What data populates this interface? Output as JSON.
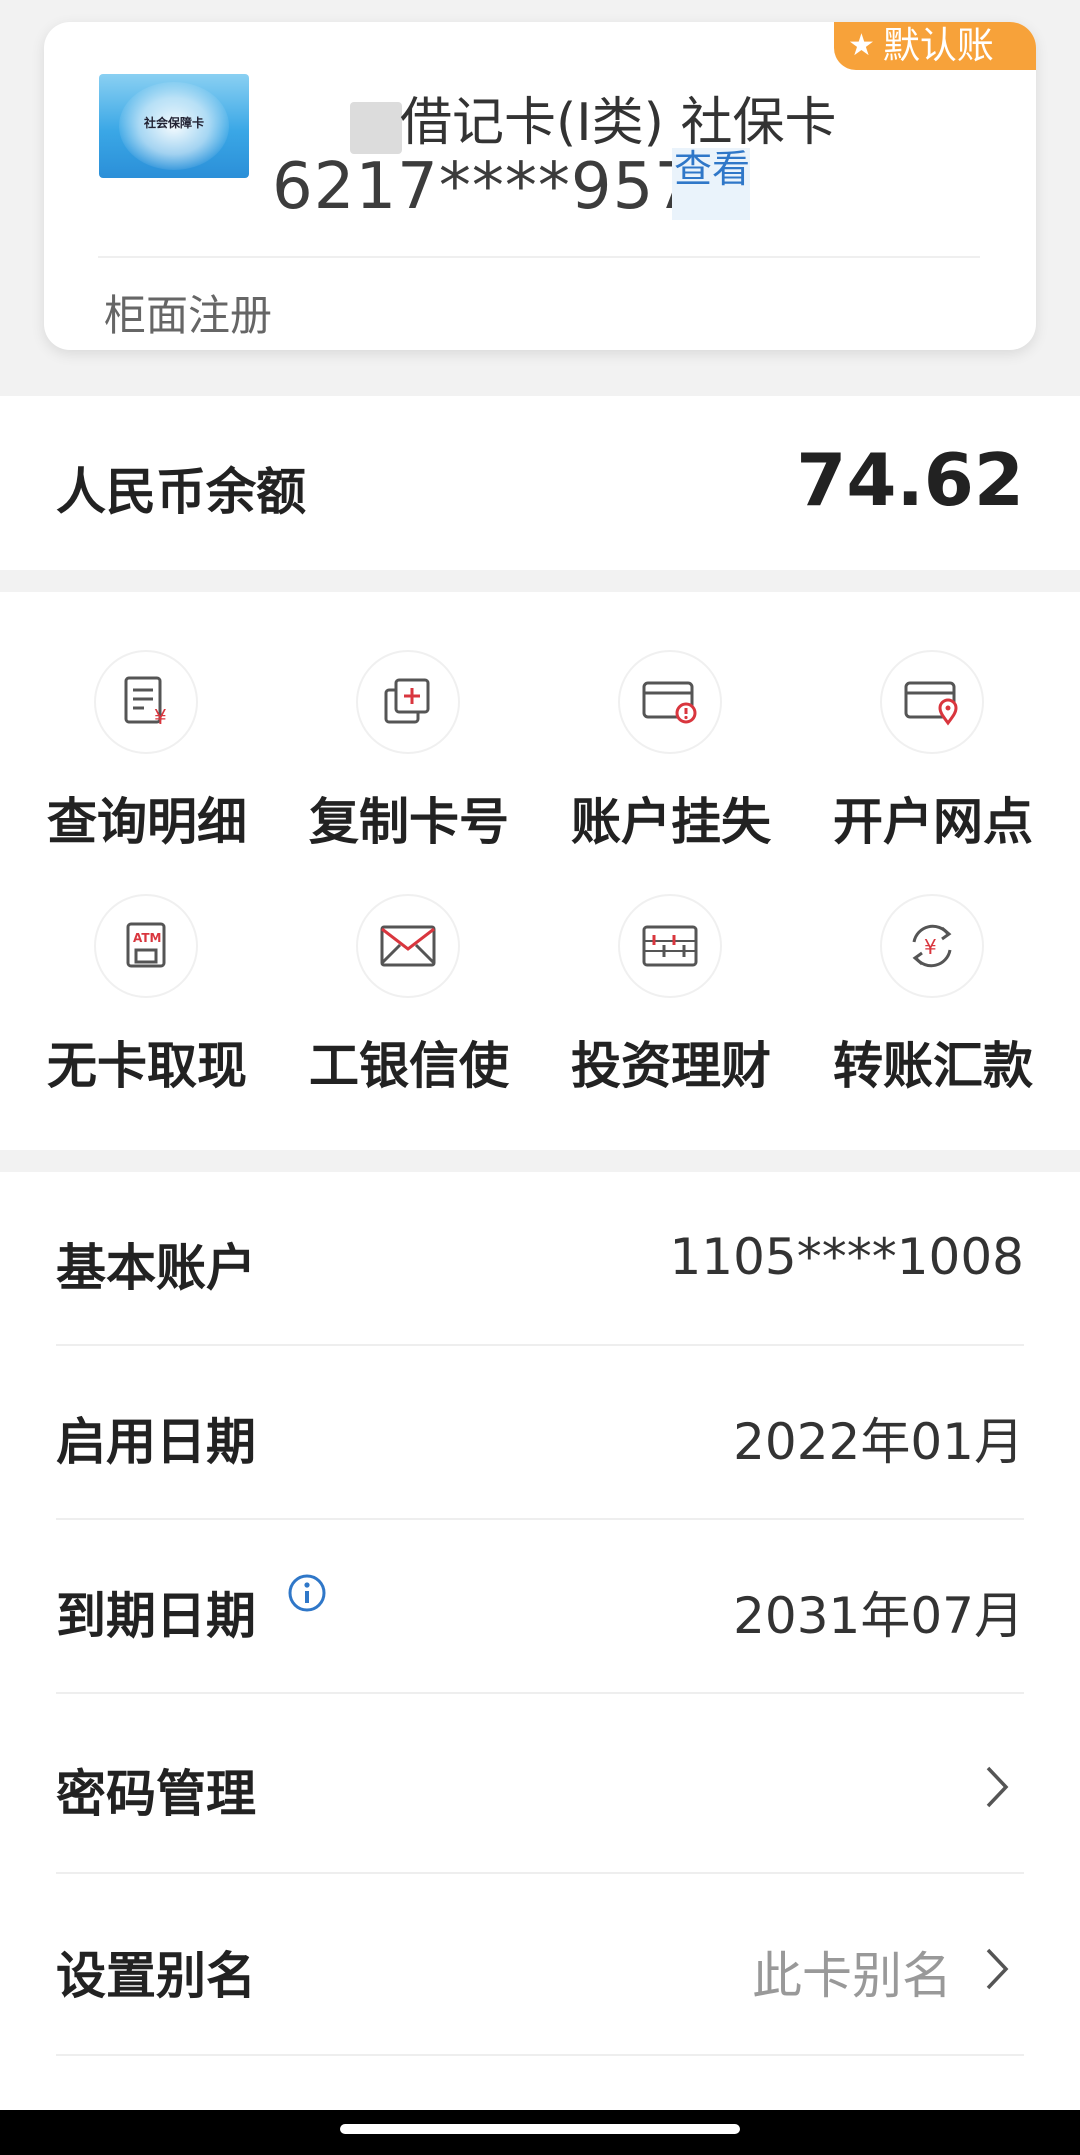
{
  "card": {
    "badge_label": "默认账",
    "image_text": "社会保障卡",
    "card_name": "借记卡(I类) 社保卡",
    "card_number": "6217****9573",
    "view_label": "查看",
    "note": "柜面注册"
  },
  "balance": {
    "label": "人民币余额",
    "value": "74.62"
  },
  "functions": [
    {
      "label": "查询明细",
      "icon": "statement-icon"
    },
    {
      "label": "复制卡号",
      "icon": "copy-icon"
    },
    {
      "label": "账户挂失",
      "icon": "card-loss-icon"
    },
    {
      "label": "开户网点",
      "icon": "card-location-icon"
    },
    {
      "label": "无卡取现",
      "icon": "atm-icon"
    },
    {
      "label": "工银信使",
      "icon": "envelope-icon"
    },
    {
      "label": "投资理财",
      "icon": "abacus-icon"
    },
    {
      "label": "转账汇款",
      "icon": "transfer-icon"
    }
  ],
  "info": {
    "basic_account": {
      "label": "基本账户",
      "value": "1105****1008"
    },
    "start_date": {
      "label": "启用日期",
      "value": "2022年01月"
    },
    "expiry_date": {
      "label": "到期日期",
      "value": "2031年07月"
    },
    "password": {
      "label": "密码管理"
    },
    "alias": {
      "label": "设置别名",
      "placeholder": "此卡别名"
    }
  },
  "colors": {
    "badge": "#f7a23a",
    "icon_red": "#d9363e",
    "link_blue": "#2f77c8"
  }
}
